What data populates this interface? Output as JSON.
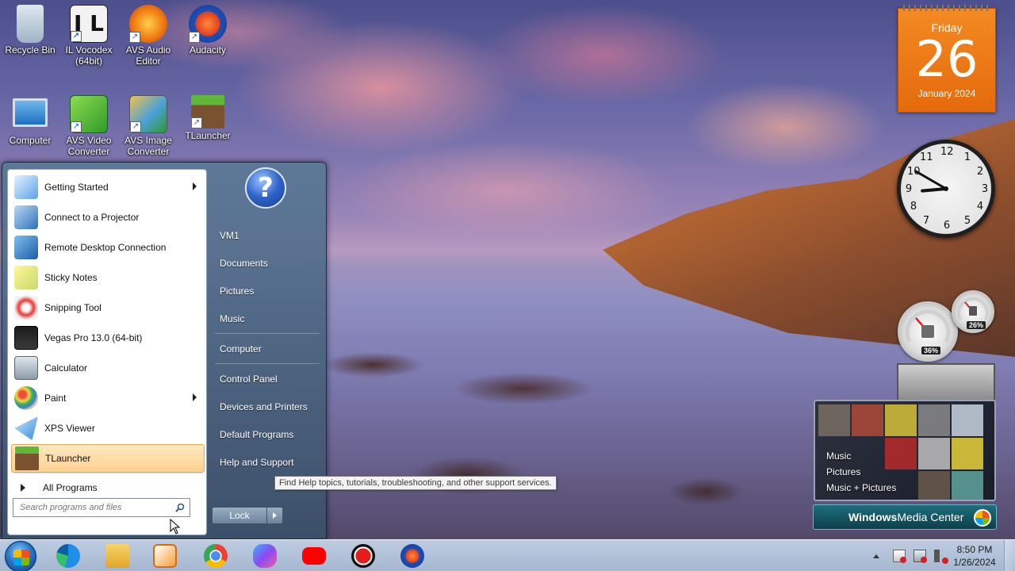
{
  "desktop": {
    "icons": [
      {
        "label": "Recycle Bin",
        "icon": "recycle-bin-icon"
      },
      {
        "label": "IL Vocodex (64bit)",
        "icon": "il-vocodex-icon"
      },
      {
        "label": "AVS Audio Editor",
        "icon": "avs-audio-editor-icon"
      },
      {
        "label": "Audacity",
        "icon": "audacity-icon"
      },
      {
        "label": "Computer",
        "icon": "computer-icon"
      },
      {
        "label": "AVS Video Converter",
        "icon": "avs-video-converter-icon"
      },
      {
        "label": "AVS Image Converter",
        "icon": "avs-image-converter-icon"
      },
      {
        "label": "TLauncher",
        "icon": "tlauncher-icon"
      }
    ]
  },
  "start_menu": {
    "programs": [
      {
        "label": "Getting Started",
        "has_submenu": true
      },
      {
        "label": "Connect to a Projector",
        "has_submenu": false
      },
      {
        "label": "Remote Desktop Connection",
        "has_submenu": false
      },
      {
        "label": "Sticky Notes",
        "has_submenu": false
      },
      {
        "label": "Snipping Tool",
        "has_submenu": false
      },
      {
        "label": "Vegas Pro 13.0 (64-bit)",
        "has_submenu": false
      },
      {
        "label": "Calculator",
        "has_submenu": false
      },
      {
        "label": "Paint",
        "has_submenu": true
      },
      {
        "label": "XPS Viewer",
        "has_submenu": false
      },
      {
        "label": "TLauncher",
        "has_submenu": false,
        "highlighted": true
      }
    ],
    "all_programs": "All Programs",
    "search_placeholder": "Search programs and files",
    "right_items": [
      "VM1",
      "Documents",
      "Pictures",
      "Music",
      "Computer",
      "Control Panel",
      "Devices and Printers",
      "Default Programs",
      "Help and Support"
    ],
    "lock_label": "Lock",
    "tooltip": "Find Help topics, tutorials, troubleshooting, and other support services."
  },
  "gadgets": {
    "calendar": {
      "day": "Friday",
      "date": "26",
      "month": "January 2024"
    },
    "clock": {
      "hour": 8,
      "minute": 50
    },
    "meters": {
      "cpu": "36%",
      "memory": "26%"
    },
    "media_center": {
      "items": [
        "Music",
        "Pictures",
        "Music + Pictures"
      ],
      "title_bold": "Windows",
      "title_rest": " Media Center"
    }
  },
  "taskbar": {
    "apps": [
      "edge-icon",
      "file-explorer-icon",
      "media-player-icon",
      "chrome-icon",
      "copilot-icon",
      "youtube-icon",
      "record-icon",
      "audacity-icon"
    ],
    "time": "8:50 PM",
    "date": "1/26/2024"
  },
  "colors": {
    "calendar_orange": "#e8720f",
    "highlight": "#fcd08e",
    "taskbar": "#b4c6dc"
  }
}
